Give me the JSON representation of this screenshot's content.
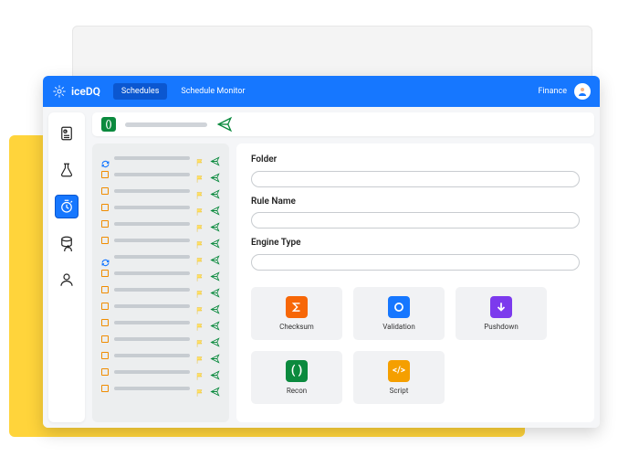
{
  "brand": "iceDQ",
  "header": {
    "tabs": [
      {
        "label": "Schedules",
        "active": true
      },
      {
        "label": "Schedule Monitor",
        "active": false
      }
    ],
    "workspace": "Finance"
  },
  "sidenav": {
    "items": [
      {
        "name": "reports-icon"
      },
      {
        "name": "lab-icon"
      },
      {
        "name": "schedule-icon",
        "active": true
      },
      {
        "name": "database-icon"
      },
      {
        "name": "user-icon"
      }
    ]
  },
  "list": {
    "count": 15
  },
  "form": {
    "folder_label": "Folder",
    "rule_label": "Rule Name",
    "engine_label": "Engine Type"
  },
  "tiles": [
    {
      "name": "checksum",
      "label": "Checksum",
      "color": "c-orange",
      "glyph": "Σ"
    },
    {
      "name": "validation",
      "label": "Validation",
      "color": "c-blue",
      "glyph": "○"
    },
    {
      "name": "pushdown",
      "label": "Pushdown",
      "color": "c-purple",
      "glyph": "↓"
    },
    {
      "name": "recon",
      "label": "Recon",
      "color": "c-green",
      "glyph": "()"
    },
    {
      "name": "script",
      "label": "Script",
      "color": "c-amber",
      "glyph": "</>"
    }
  ]
}
